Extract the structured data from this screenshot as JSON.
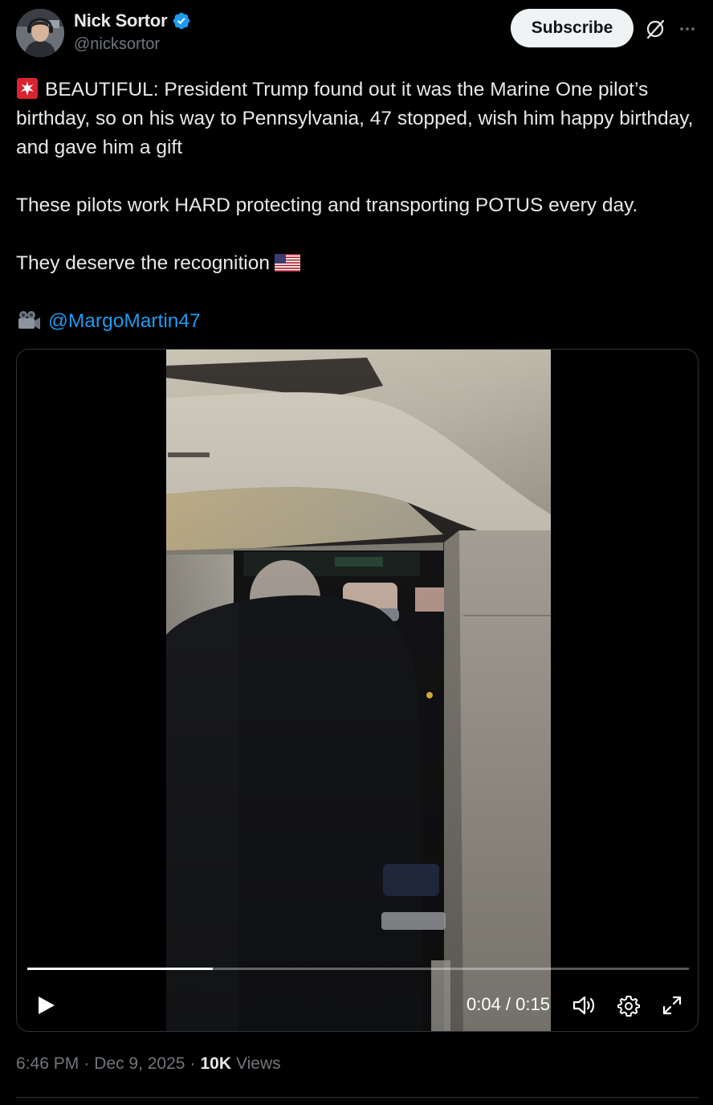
{
  "author": {
    "display_name": "Nick Sortor",
    "handle": "@nicksortor",
    "verified": true,
    "verified_color": "#1d9bf0"
  },
  "actions": {
    "subscribe_label": "Subscribe",
    "grok_icon": "grok-icon",
    "more_icon": "more-icon"
  },
  "post": {
    "line1_lead_emoji": "rotating-light",
    "paragraph1": "BEAUTIFUL: President Trump found out it was the Marine One pilot’s birthday, so on his way to Pennsylvania, 47 stopped, wish him happy birthday, and gave him a gift",
    "paragraph2": "These pilots work HARD protecting and transporting POTUS every day.",
    "paragraph3": "They deserve the recognition",
    "paragraph3_trailing_emoji": "us-flag",
    "credit_emoji": "movie-camera",
    "credit_mention": "@MargoMartin47",
    "mention_color": "#1d9bf0"
  },
  "video": {
    "current_time": "0:04",
    "duration": "0:15",
    "time_display": "0:04 / 0:15",
    "progress_fraction": 0.28,
    "controls": [
      "play-icon",
      "volume-icon",
      "settings-icon",
      "fullscreen-icon"
    ]
  },
  "meta": {
    "time": "6:46 PM",
    "date": "Dec 9, 2025",
    "views_count": "10K",
    "views_label": "Views",
    "separator": "·"
  }
}
